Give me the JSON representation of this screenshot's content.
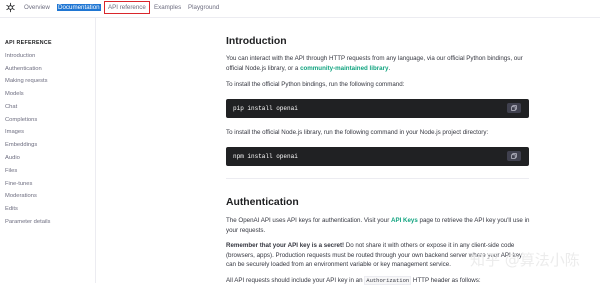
{
  "topnav": {
    "overview": "Overview",
    "documentation": "Documentation",
    "api_reference": "API reference",
    "examples": "Examples",
    "playground": "Playground"
  },
  "sidebar": {
    "heading": "API REFERENCE",
    "items": [
      "Introduction",
      "Authentication",
      "Making requests",
      "Models",
      "Chat",
      "Completions",
      "Images",
      "Embeddings",
      "Audio",
      "Files",
      "Fine-tunes",
      "Moderations",
      "Edits",
      "Parameter details"
    ]
  },
  "intro": {
    "title": "Introduction",
    "p1_a": "You can interact with the API through HTTP requests from any language, via our official Python bindings, our official Node.js library, or a ",
    "p1_link": "community-maintained library",
    "p1_b": ".",
    "p2": "To install the official Python bindings, run the following command:",
    "code1": "pip install openai",
    "p3": "To install the official Node.js library, run the following command in your Node.js project directory:",
    "code2": "npm install openai"
  },
  "auth": {
    "title": "Authentication",
    "p1_a": "The OpenAI API uses API keys for authentication. Visit your ",
    "p1_link": "API Keys",
    "p1_b": " page to retrieve the API key you'll use in your requests.",
    "p2_bold": "Remember that your API key is a secret!",
    "p2_rest": " Do not share it with others or expose it in any client-side code (browsers, apps). Production requests must be routed through your own backend server where your API key can be securely loaded from an environment variable or key management service.",
    "p3_a": "All API requests should include your API key in an ",
    "p3_code": "Authorization",
    "p3_b": " HTTP header as follows:"
  },
  "watermark": "知乎 @算法小陈"
}
